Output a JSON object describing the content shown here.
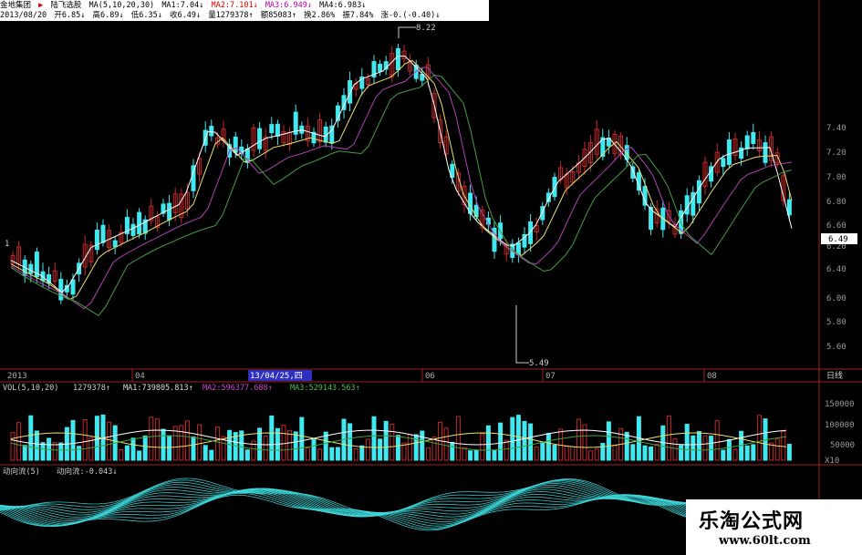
{
  "header": {
    "company": "金地集团",
    "date": "2013/08/20",
    "indicator": "陆飞选股",
    "ma_label": "MA(5,10,20,30)",
    "ma1": "MA1:7.04↓",
    "ma2": "MA2:7.101↓",
    "ma3": "MA3:6.949↓",
    "ma4": "MA4:6.983↓",
    "open": "开6.85↓",
    "high": "高6.89↓",
    "low": "低6.35↓",
    "close": "收6.49↓",
    "volume": "量1279378↑",
    "amount": "额85083↑",
    "turnover": "换2.86%",
    "amplitude": "振7.84%",
    "change": "涨-0.(-0.40)↓"
  },
  "price_axis": {
    "ticks": [
      "7.40",
      "7.20",
      "7.00",
      "6.80",
      "6.60",
      "6.40",
      "6.20",
      "6.00",
      "5.80",
      "5.60"
    ],
    "current": "6.49"
  },
  "annotations": {
    "high": "8.22",
    "low": "5.49",
    "left_marker": "1"
  },
  "date_axis": {
    "ticks": [
      "2013",
      "04",
      "06",
      "07",
      "08"
    ],
    "selected": "13/04/25,四",
    "period": "日线"
  },
  "volume_panel": {
    "label": "VOL(5,10,20)",
    "vol": "1279378↑",
    "ma1": "MA1:739805.813↑",
    "ma2": "MA2:596377.688↑",
    "ma3": "MA3:529143.563↑",
    "ticks": [
      "150000",
      "100000",
      "50000"
    ],
    "unit": "X10"
  },
  "flow_panel": {
    "label": "动向流(5)",
    "value": "动向流:-0.043↓"
  },
  "watermark": {
    "title": "乐淘公式网",
    "url": "www.60lt.com"
  },
  "colors": {
    "up": "#c62828",
    "down": "#40e8f0",
    "ma5": "#ffffff",
    "ma10": "#e8e070",
    "ma20": "#b040b0",
    "ma30": "#40a040",
    "axis": "#a02020"
  }
}
